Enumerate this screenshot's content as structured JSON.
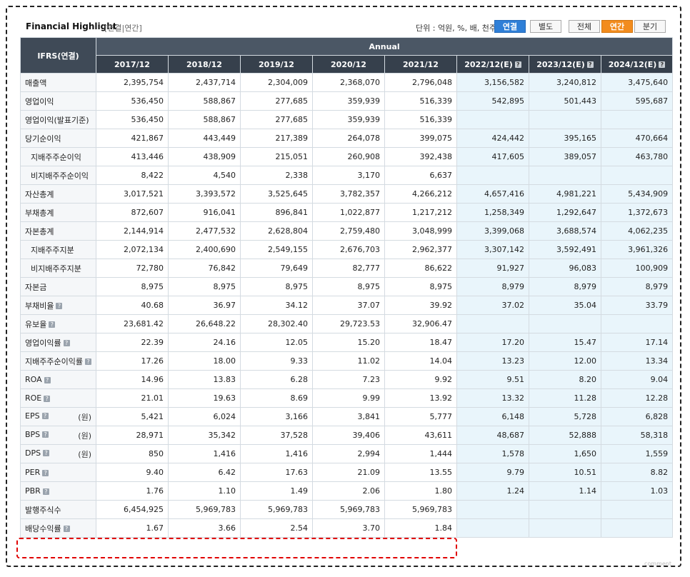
{
  "header": {
    "title": "Financial Highlight",
    "subtitle": "[연결|연간]",
    "unit": "단위 : 억원, %, 배, 천주",
    "buttons": {
      "consolidated": "연결",
      "separate": "별도",
      "all": "전체",
      "annual": "연간",
      "quarter": "분기"
    }
  },
  "table": {
    "corner": "IFRS(연결)",
    "annual_label": "Annual",
    "years": [
      "2017/12",
      "2018/12",
      "2019/12",
      "2020/12",
      "2021/12",
      "2022/12(E)",
      "2023/12(E)",
      "2024/12(E)"
    ],
    "rows": [
      {
        "label": "매출액",
        "values": [
          "2,395,754",
          "2,437,714",
          "2,304,009",
          "2,368,070",
          "2,796,048",
          "3,156,582",
          "3,240,812",
          "3,475,640"
        ]
      },
      {
        "label": "영업이익",
        "values": [
          "536,450",
          "588,867",
          "277,685",
          "359,939",
          "516,339",
          "542,895",
          "501,443",
          "595,687"
        ]
      },
      {
        "label": "영업이익(발표기준)",
        "values": [
          "536,450",
          "588,867",
          "277,685",
          "359,939",
          "516,339",
          "",
          "",
          ""
        ]
      },
      {
        "label": "당기순이익",
        "values": [
          "421,867",
          "443,449",
          "217,389",
          "264,078",
          "399,075",
          "424,442",
          "395,165",
          "470,664"
        ]
      },
      {
        "label": "지배주주순이익",
        "indent": true,
        "values": [
          "413,446",
          "438,909",
          "215,051",
          "260,908",
          "392,438",
          "417,605",
          "389,057",
          "463,780"
        ]
      },
      {
        "label": "비지배주주순이익",
        "indent": true,
        "values": [
          "8,422",
          "4,540",
          "2,338",
          "3,170",
          "6,637",
          "",
          "",
          ""
        ]
      },
      {
        "label": "자산총계",
        "values": [
          "3,017,521",
          "3,393,572",
          "3,525,645",
          "3,782,357",
          "4,266,212",
          "4,657,416",
          "4,981,221",
          "5,434,909"
        ]
      },
      {
        "label": "부채총계",
        "values": [
          "872,607",
          "916,041",
          "896,841",
          "1,022,877",
          "1,217,212",
          "1,258,349",
          "1,292,647",
          "1,372,673"
        ]
      },
      {
        "label": "자본총계",
        "values": [
          "2,144,914",
          "2,477,532",
          "2,628,804",
          "2,759,480",
          "3,048,999",
          "3,399,068",
          "3,688,574",
          "4,062,235"
        ]
      },
      {
        "label": "지배주주지분",
        "indent": true,
        "values": [
          "2,072,134",
          "2,400,690",
          "2,549,155",
          "2,676,703",
          "2,962,377",
          "3,307,142",
          "3,592,491",
          "3,961,326"
        ]
      },
      {
        "label": "비지배주주지분",
        "indent": true,
        "values": [
          "72,780",
          "76,842",
          "79,649",
          "82,777",
          "86,622",
          "91,927",
          "96,083",
          "100,909"
        ]
      },
      {
        "label": "자본금",
        "values": [
          "8,975",
          "8,975",
          "8,975",
          "8,975",
          "8,975",
          "8,979",
          "8,979",
          "8,979"
        ]
      },
      {
        "label": "부채비율",
        "help": true,
        "values": [
          "40.68",
          "36.97",
          "34.12",
          "37.07",
          "39.92",
          "37.02",
          "35.04",
          "33.79"
        ]
      },
      {
        "label": "유보율",
        "help": true,
        "values": [
          "23,681.42",
          "26,648.22",
          "28,302.40",
          "29,723.53",
          "32,906.47",
          "",
          "",
          ""
        ]
      },
      {
        "label": "영업이익률",
        "help": true,
        "values": [
          "22.39",
          "24.16",
          "12.05",
          "15.20",
          "18.47",
          "17.20",
          "15.47",
          "17.14"
        ]
      },
      {
        "label": "지배주주순이익률",
        "help": true,
        "values": [
          "17.26",
          "18.00",
          "9.33",
          "11.02",
          "14.04",
          "13.23",
          "12.00",
          "13.34"
        ]
      },
      {
        "label": "ROA",
        "help": true,
        "values": [
          "14.96",
          "13.83",
          "6.28",
          "7.23",
          "9.92",
          "9.51",
          "8.20",
          "9.04"
        ]
      },
      {
        "label": "ROE",
        "help": true,
        "values": [
          "21.01",
          "19.63",
          "8.69",
          "9.99",
          "13.92",
          "13.32",
          "11.28",
          "12.28"
        ]
      },
      {
        "label": "EPS",
        "help": true,
        "unit": "(원)",
        "values": [
          "5,421",
          "6,024",
          "3,166",
          "3,841",
          "5,777",
          "6,148",
          "5,728",
          "6,828"
        ]
      },
      {
        "label": "BPS",
        "help": true,
        "unit": "(원)",
        "values": [
          "28,971",
          "35,342",
          "37,528",
          "39,406",
          "43,611",
          "48,687",
          "52,888",
          "58,318"
        ]
      },
      {
        "label": "DPS",
        "help": true,
        "unit": "(원)",
        "values": [
          "850",
          "1,416",
          "1,416",
          "2,994",
          "1,444",
          "1,578",
          "1,650",
          "1,559"
        ]
      },
      {
        "label": "PER",
        "help": true,
        "values": [
          "9.40",
          "6.42",
          "17.63",
          "21.09",
          "13.55",
          "9.79",
          "10.51",
          "8.82"
        ]
      },
      {
        "label": "PBR",
        "help": true,
        "values": [
          "1.76",
          "1.10",
          "1.49",
          "2.06",
          "1.80",
          "1.24",
          "1.14",
          "1.03"
        ]
      },
      {
        "label": "발행주식수",
        "values": [
          "6,454,925",
          "5,969,783",
          "5,969,783",
          "5,969,783",
          "5,969,783",
          "",
          "",
          ""
        ]
      },
      {
        "label": "배당수익률",
        "help": true,
        "values": [
          "1.67",
          "3.66",
          "2.54",
          "3.70",
          "1.84",
          "",
          "",
          ""
        ]
      }
    ]
  },
  "colors": {
    "header_bg": "#3f4a57",
    "estimate_bg": "#e9f5fb",
    "highlight": "#e00000",
    "active_blue": "#2f7fd7",
    "active_orange": "#f28c1e"
  },
  "footer": "comment"
}
